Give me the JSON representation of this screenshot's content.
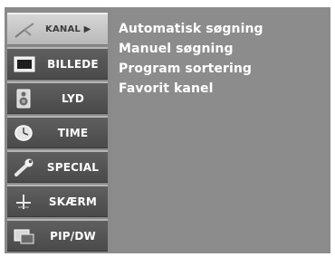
{
  "sidebar": {
    "items": [
      {
        "label": "KANAL ▶",
        "icon": "antenna-icon",
        "active": true
      },
      {
        "label": "BILLEDE",
        "icon": "tv-screen-icon",
        "active": false
      },
      {
        "label": "LYD",
        "icon": "speaker-icon",
        "active": false
      },
      {
        "label": "TIME",
        "icon": "clock-icon",
        "active": false
      },
      {
        "label": "SPECIAL",
        "icon": "wrench-icon",
        "active": false
      },
      {
        "label": "SKÆRM",
        "icon": "crosshair-icon",
        "active": false
      },
      {
        "label": "PIP/DW",
        "icon": "pip-window-icon",
        "active": false
      }
    ]
  },
  "submenu": {
    "options": [
      "Automatisk  søgning",
      "Manuel  søgning",
      "Program  sortering",
      "Favorit kanel"
    ]
  },
  "colors": {
    "panel": "#8c8c8c",
    "item": "#555555",
    "active_item": "#c8c8c8",
    "text": "#ffffff"
  }
}
